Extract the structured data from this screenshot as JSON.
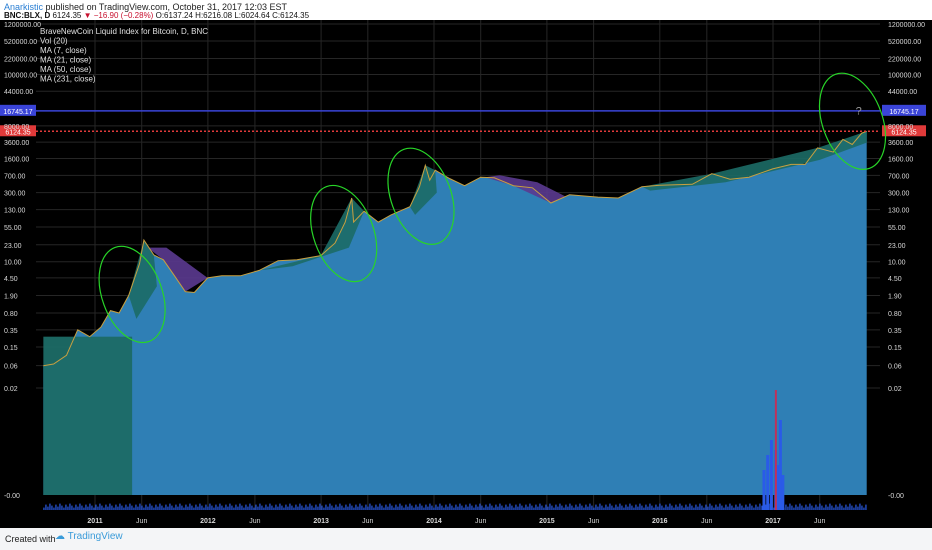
{
  "header": {
    "author": "Anarkistic",
    "published_text": "published on TradingView.com, October 31, 2017 12:03 EST",
    "symbol": "BNC:BLX, D",
    "last_price": "6124.35",
    "change": "▼ −16.90 (−0.28%)",
    "ohlc": "O:6137.24 H:6216.08 L:6024.64 C:6124.35"
  },
  "legend": [
    "BraveNewCoin Liquid Index for Bitcoin, D, BNC",
    "Vol (20)",
    "MA (7, close)",
    "MA (21, close)",
    "MA (50, close)",
    "MA (231, close)"
  ],
  "footer": {
    "created_with": "Created with",
    "brand": "TradingView"
  },
  "colors": {
    "background": "#000000",
    "area_fill": "#2f7fb5",
    "teal_cloud": "#1c6b66",
    "purple_cloud": "#5b3a90",
    "volume": "#2a5be8",
    "resistance_line": "#3a44d8",
    "current_price_line": "#e03a3a",
    "annotation": "#28d428",
    "axis_text": "#d8d8d8"
  },
  "chart_data": {
    "type": "line",
    "title": "BraveNewCoin Liquid Index for Bitcoin, D, BNC",
    "y_scale": "log",
    "y_tick_labels": [
      "1200000.00",
      "520000.00",
      "220000.00",
      "100000.00",
      "44000.00",
      "8000.00",
      "3600.00",
      "1600.00",
      "700.00",
      "300.00",
      "130.00",
      "55.00",
      "23.00",
      "10.00",
      "4.50",
      "1.90",
      "0.80",
      "0.35",
      "0.15",
      "0.06",
      "0.02",
      "-0.00"
    ],
    "y_tick_values": [
      1200000,
      520000,
      220000,
      100000,
      44000,
      8000,
      3600,
      1600,
      700,
      300,
      130,
      55,
      23,
      10,
      4.5,
      1.9,
      0.8,
      0.35,
      0.15,
      0.06,
      0.02
    ],
    "x_tick_labels": [
      "2011",
      "Jun",
      "2012",
      "Jun",
      "2013",
      "Jun",
      "2014",
      "Jun",
      "2015",
      "Jun",
      "2016",
      "Jun",
      "2017",
      "Jun"
    ],
    "x_tick_dates": [
      "2011-01-01",
      "2011-06-01",
      "2012-01-01",
      "2012-06-01",
      "2013-01-01",
      "2013-06-01",
      "2014-01-01",
      "2014-06-01",
      "2015-01-01",
      "2015-06-01",
      "2016-01-01",
      "2016-06-01",
      "2017-01-01",
      "2017-06-01"
    ],
    "x_range": [
      "2010-07-18",
      "2017-10-31"
    ],
    "price_series": [
      [
        "2010-07-18",
        0.06
      ],
      [
        "2010-08-20",
        0.065
      ],
      [
        "2010-10-01",
        0.1
      ],
      [
        "2010-11-06",
        0.35
      ],
      [
        "2010-12-15",
        0.25
      ],
      [
        "2011-01-20",
        0.4
      ],
      [
        "2011-02-20",
        0.9
      ],
      [
        "2011-03-20",
        0.8
      ],
      [
        "2011-04-20",
        1.9
      ],
      [
        "2011-05-25",
        9
      ],
      [
        "2011-06-08",
        29
      ],
      [
        "2011-07-10",
        14
      ],
      [
        "2011-08-10",
        11
      ],
      [
        "2011-09-15",
        5
      ],
      [
        "2011-10-20",
        2.3
      ],
      [
        "2011-11-18",
        2.2
      ],
      [
        "2011-12-31",
        4.5
      ],
      [
        "2012-02-15",
        5
      ],
      [
        "2012-04-15",
        5
      ],
      [
        "2012-06-15",
        6.5
      ],
      [
        "2012-08-15",
        10.5
      ],
      [
        "2012-10-15",
        11
      ],
      [
        "2012-12-31",
        13.5
      ],
      [
        "2013-02-15",
        25
      ],
      [
        "2013-03-20",
        70
      ],
      [
        "2013-04-10",
        230
      ],
      [
        "2013-04-16",
        70
      ],
      [
        "2013-05-20",
        120
      ],
      [
        "2013-07-05",
        70
      ],
      [
        "2013-08-15",
        100
      ],
      [
        "2013-10-15",
        150
      ],
      [
        "2013-11-15",
        400
      ],
      [
        "2013-12-04",
        1150
      ],
      [
        "2013-12-18",
        550
      ],
      [
        "2014-01-05",
        900
      ],
      [
        "2014-02-20",
        600
      ],
      [
        "2014-04-10",
        420
      ],
      [
        "2014-06-01",
        640
      ],
      [
        "2014-07-15",
        620
      ],
      [
        "2014-09-15",
        420
      ],
      [
        "2014-11-15",
        380
      ],
      [
        "2015-01-14",
        180
      ],
      [
        "2015-03-15",
        270
      ],
      [
        "2015-06-15",
        240
      ],
      [
        "2015-08-20",
        230
      ],
      [
        "2015-11-04",
        400
      ],
      [
        "2015-12-31",
        430
      ],
      [
        "2016-04-15",
        450
      ],
      [
        "2016-06-17",
        760
      ],
      [
        "2016-08-15",
        580
      ],
      [
        "2016-10-15",
        640
      ],
      [
        "2016-12-31",
        960
      ],
      [
        "2017-03-01",
        1200
      ],
      [
        "2017-04-15",
        1200
      ],
      [
        "2017-05-25",
        2700
      ],
      [
        "2017-07-15",
        2200
      ],
      [
        "2017-08-15",
        4100
      ],
      [
        "2017-09-14",
        3200
      ],
      [
        "2017-10-15",
        5600
      ],
      [
        "2017-10-31",
        6124.35
      ]
    ],
    "horizontal_levels": [
      {
        "price": 16745.17,
        "label": "16745.17",
        "color": "#3a44d8"
      },
      {
        "price": 6124.35,
        "label": "6124.35",
        "color": "#e03a3a"
      }
    ],
    "volume_spike_dates": [
      "2016-11-28",
      "2016-12-10",
      "2016-12-22",
      "2017-01-05",
      "2017-01-12",
      "2017-01-20",
      "2017-01-28"
    ],
    "annotations": [
      {
        "type": "ellipse",
        "date": "2011-05-01",
        "price": 2,
        "color": "#28d428"
      },
      {
        "type": "ellipse",
        "date": "2013-03-15",
        "price": 40,
        "color": "#28d428"
      },
      {
        "type": "ellipse",
        "date": "2013-11-20",
        "price": 250,
        "color": "#28d428"
      },
      {
        "type": "ellipse",
        "date": "2017-09-15",
        "price": 10000,
        "color": "#28d428"
      },
      {
        "type": "text",
        "text": "?",
        "date": "2017-09-25",
        "price": 14000,
        "color": "#9a9a9a"
      }
    ]
  }
}
